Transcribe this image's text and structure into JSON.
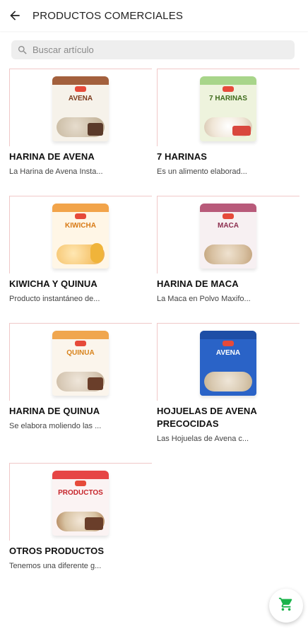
{
  "header": {
    "title": "PRODUCTOS COMERCIALES",
    "back_icon": "arrow-back-icon"
  },
  "search": {
    "placeholder": "Buscar artículo",
    "value": ""
  },
  "products": [
    {
      "title": "HARINA DE AVENA",
      "description": "La Harina de Avena Insta...",
      "band_color": "#a3603d"
    },
    {
      "title": "7 HARINAS",
      "description": "Es un alimento elaborad...",
      "band_color": "#a8d58a"
    },
    {
      "title": "KIWICHA Y QUINUA",
      "description": "Producto instantáneo de...",
      "band_color": "#f2a44a"
    },
    {
      "title": "HARINA DE MACA",
      "description": "La Maca en Polvo Maxifo...",
      "band_color": "#b85a7a"
    },
    {
      "title": "HARINA DE QUINUA",
      "description": "Se elabora moliendo las ...",
      "band_color": "#f0a64e"
    },
    {
      "title": "HOJUELAS DE AVENA PRECOCIDAS",
      "description": "Las Hojuelas de Avena c...",
      "band_color": "#2a63c7"
    },
    {
      "title": "OTROS PRODUCTOS",
      "description": "Tenemos una diferente g...",
      "band_color": "#e64545"
    }
  ],
  "fab": {
    "icon": "shopping-cart-icon",
    "color": "#19b34a"
  }
}
